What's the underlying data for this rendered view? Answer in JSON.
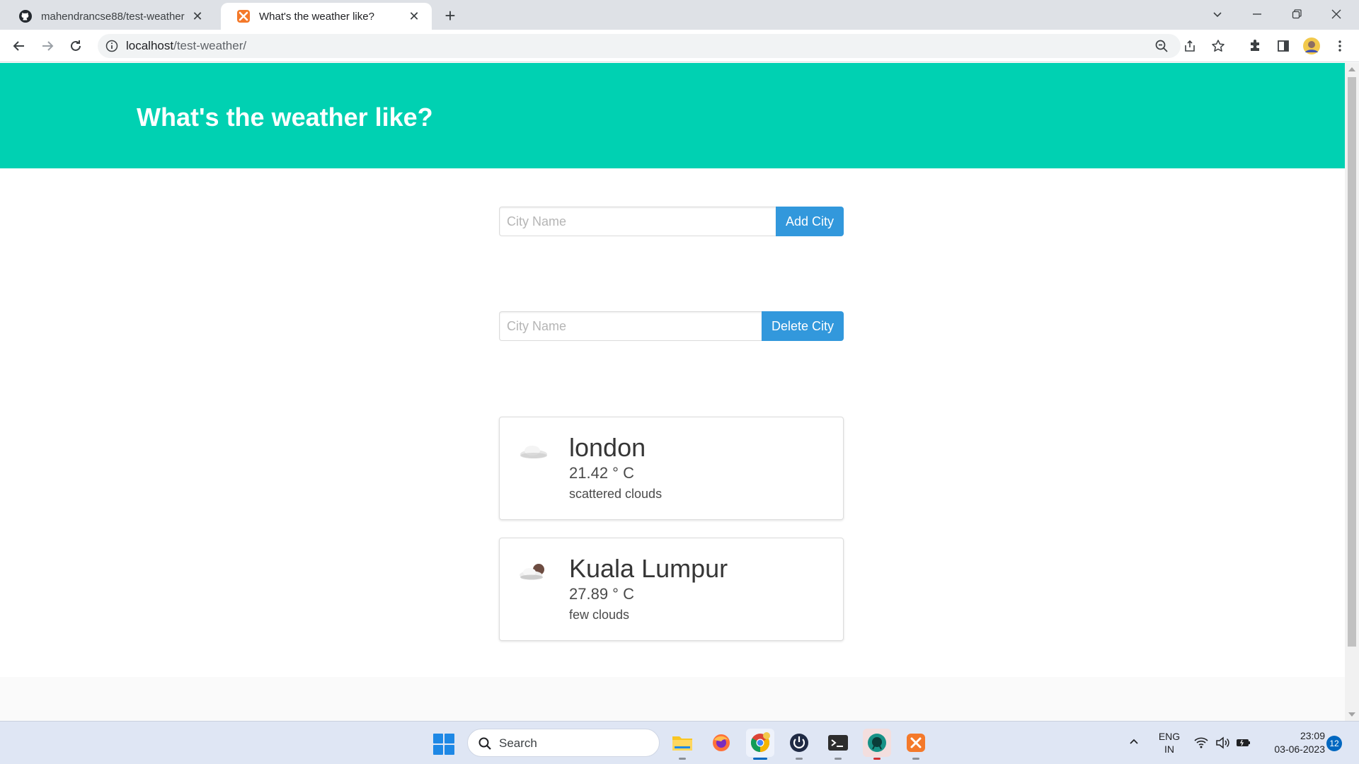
{
  "browser": {
    "tabs": [
      {
        "title": "mahendrancse88/test-weather",
        "icon": "github-icon",
        "active": false
      },
      {
        "title": "What's the weather like?",
        "icon": "xampp-icon",
        "active": true
      }
    ],
    "new_tab": "+",
    "close_glyph": "✕",
    "url_host": "localhost",
    "url_path": "/test-weather/"
  },
  "page": {
    "title": "What's the weather like?",
    "add_form": {
      "placeholder": "City Name",
      "button": "Add City"
    },
    "delete_form": {
      "placeholder": "City Name",
      "button": "Delete City"
    },
    "cities": [
      {
        "name": "london",
        "temp": "21.42 ° C",
        "description": "scattered clouds",
        "icon": "scattered-clouds-icon"
      },
      {
        "name": "Kuala Lumpur",
        "temp": "27.89 ° C",
        "description": "few clouds",
        "icon": "few-clouds-icon"
      }
    ]
  },
  "taskbar": {
    "search_label": "Search",
    "lang_line1": "ENG",
    "lang_line2": "IN",
    "time": "23:09",
    "date": "03-06-2023",
    "notifications": "12",
    "accent": "#0067c0"
  },
  "colors": {
    "hero": "#00d1b2",
    "button": "#3298dc"
  }
}
